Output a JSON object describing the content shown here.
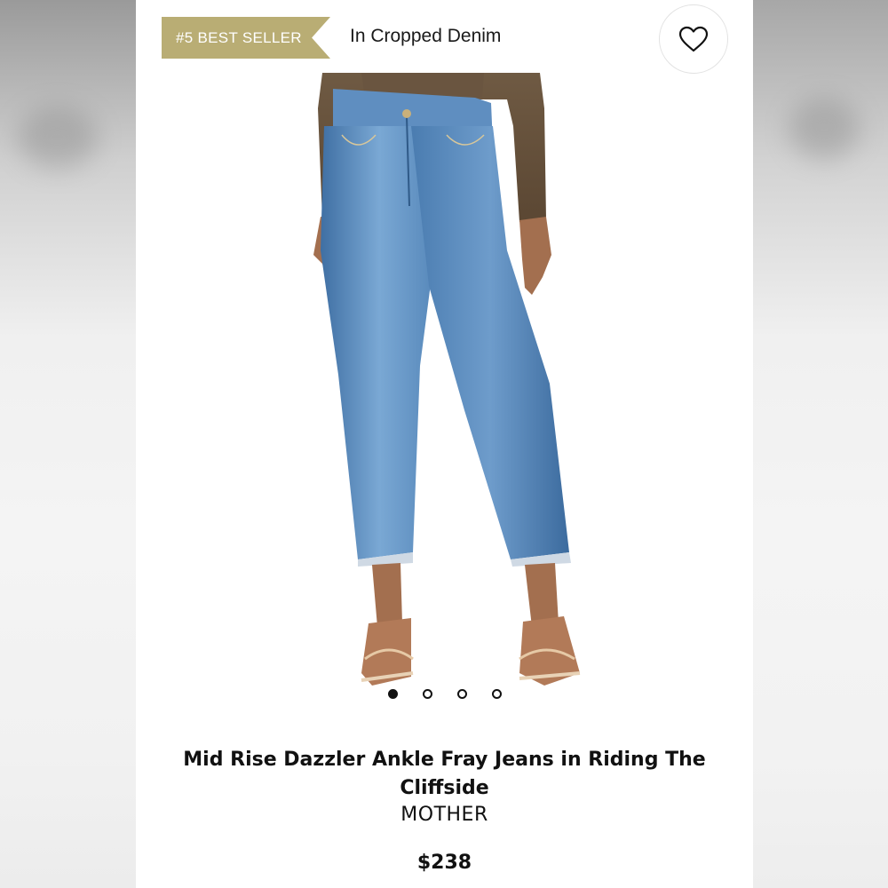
{
  "badge": {
    "label": "#5 BEST SELLER",
    "color": "#b9ad74"
  },
  "category": {
    "label": "In Cropped Denim"
  },
  "favorite": {
    "icon": "heart-icon"
  },
  "image": {
    "subject": "product-photo",
    "carousel_total": 4,
    "carousel_active": 1
  },
  "product": {
    "title": "Mid Rise Dazzler Ankle Fray Jeans in Riding The Cliffside",
    "brand": "MOTHER",
    "price": "$238"
  },
  "colors": {
    "denim": "#5d8fc2",
    "sweater": "#6b5640",
    "skin": "#a36f4f"
  }
}
